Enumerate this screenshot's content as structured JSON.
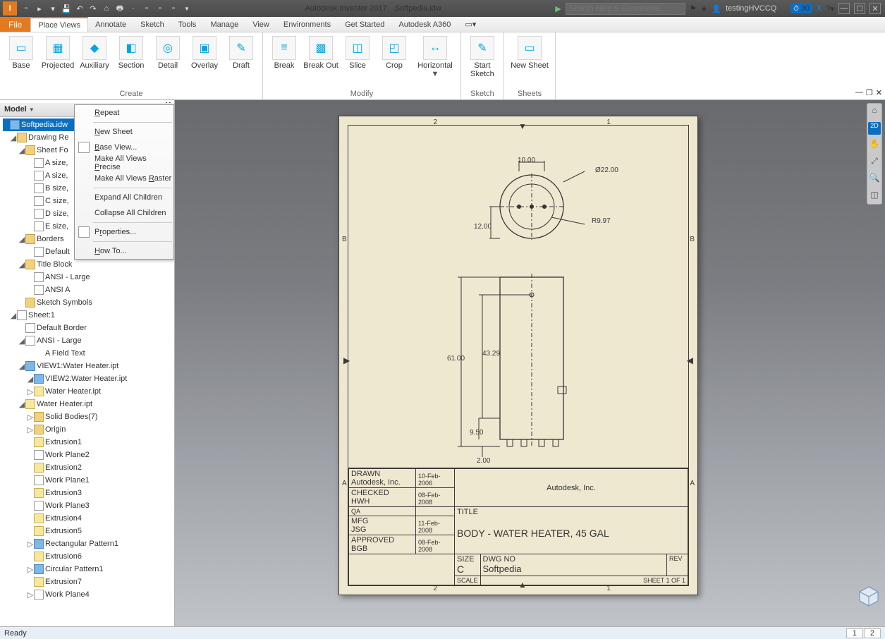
{
  "title": {
    "app": "Autodesk Inventor 2017",
    "doc": "Softpedia.idw"
  },
  "search_placeholder": "Search Help & Commands...",
  "user": "testingHVCCQ",
  "credits": "30",
  "menutabs": [
    "File",
    "Place Views",
    "Annotate",
    "Sketch",
    "Tools",
    "Manage",
    "View",
    "Environments",
    "Get Started",
    "Autodesk A360"
  ],
  "active_tab_index": 1,
  "ribbon": {
    "groups": [
      {
        "label": "Create",
        "items": [
          "Base",
          "Projected",
          "Auxiliary",
          "Section",
          "Detail",
          "Overlay",
          "Draft"
        ]
      },
      {
        "label": "Modify",
        "items": [
          "Break",
          "Break Out",
          "Slice",
          "Crop",
          "Horizontal"
        ]
      },
      {
        "label": "Sketch",
        "items": [
          "Start Sketch"
        ]
      },
      {
        "label": "Sheets",
        "items": [
          "New Sheet"
        ]
      }
    ]
  },
  "panel_title": "Model",
  "context_menu": [
    {
      "label": "Repeat",
      "u": 0
    },
    {
      "sep": true
    },
    {
      "label": "New Sheet",
      "dis": true,
      "u": 0
    },
    {
      "label": "Base View...",
      "u": 0,
      "ico": true
    },
    {
      "label": "Make All Views Precise",
      "dis": true,
      "u": 15
    },
    {
      "label": "Make All Views Raster",
      "u": 15
    },
    {
      "sep": true
    },
    {
      "label": "Expand All Children"
    },
    {
      "label": "Collapse All Children"
    },
    {
      "sep": true
    },
    {
      "label": "Properties...",
      "u": 1,
      "ico": true
    },
    {
      "sep": true
    },
    {
      "label": "How To...",
      "u": 0
    }
  ],
  "tree": [
    {
      "lvl": 0,
      "tw": "",
      "ic": "bluebox",
      "txt": "Softpedia.idw",
      "sel": true
    },
    {
      "lvl": 1,
      "tw": "◢",
      "ic": "folder",
      "txt": "Drawing Re"
    },
    {
      "lvl": 2,
      "tw": "◢",
      "ic": "folder",
      "txt": "Sheet Fo"
    },
    {
      "lvl": 3,
      "tw": "",
      "ic": "page",
      "txt": "A size,"
    },
    {
      "lvl": 3,
      "tw": "",
      "ic": "page",
      "txt": "A size,"
    },
    {
      "lvl": 3,
      "tw": "",
      "ic": "page",
      "txt": "B size,"
    },
    {
      "lvl": 3,
      "tw": "",
      "ic": "page",
      "txt": "C size,"
    },
    {
      "lvl": 3,
      "tw": "",
      "ic": "page",
      "txt": "D size,"
    },
    {
      "lvl": 3,
      "tw": "",
      "ic": "page",
      "txt": "E size,"
    },
    {
      "lvl": 2,
      "tw": "◢",
      "ic": "folder",
      "txt": "Borders"
    },
    {
      "lvl": 3,
      "tw": "",
      "ic": "page",
      "txt": "Default"
    },
    {
      "lvl": 2,
      "tw": "◢",
      "ic": "folder",
      "txt": "Title Block"
    },
    {
      "lvl": 3,
      "tw": "",
      "ic": "page",
      "txt": "ANSI - Large"
    },
    {
      "lvl": 3,
      "tw": "",
      "ic": "page",
      "txt": "ANSI A"
    },
    {
      "lvl": 2,
      "tw": "",
      "ic": "folder",
      "txt": "Sketch Symbols"
    },
    {
      "lvl": 1,
      "tw": "◢",
      "ic": "page",
      "txt": "Sheet:1"
    },
    {
      "lvl": 2,
      "tw": "",
      "ic": "page",
      "txt": "Default Border"
    },
    {
      "lvl": 2,
      "tw": "◢",
      "ic": "page",
      "txt": "ANSI - Large"
    },
    {
      "lvl": 3,
      "tw": "",
      "ic": "",
      "txt": "A Field Text"
    },
    {
      "lvl": 2,
      "tw": "◢",
      "ic": "bluebox",
      "txt": "VIEW1:Water Heater.ipt"
    },
    {
      "lvl": 3,
      "tw": "◢",
      "ic": "bluebox",
      "txt": "VIEW2:Water Heater.ipt"
    },
    {
      "lvl": 3,
      "tw": "▷",
      "ic": "cyl",
      "txt": "Water Heater.ipt"
    },
    {
      "lvl": 2,
      "tw": "◢",
      "ic": "cyl",
      "txt": "Water Heater.ipt"
    },
    {
      "lvl": 3,
      "tw": "▷",
      "ic": "folder",
      "txt": "Solid Bodies(7)"
    },
    {
      "lvl": 3,
      "tw": "▷",
      "ic": "folder",
      "txt": "Origin"
    },
    {
      "lvl": 3,
      "tw": "",
      "ic": "cyl",
      "txt": "Extrusion1"
    },
    {
      "lvl": 3,
      "tw": "",
      "ic": "page",
      "txt": "Work Plane2"
    },
    {
      "lvl": 3,
      "tw": "",
      "ic": "cyl",
      "txt": "Extrusion2"
    },
    {
      "lvl": 3,
      "tw": "",
      "ic": "page",
      "txt": "Work Plane1"
    },
    {
      "lvl": 3,
      "tw": "",
      "ic": "cyl",
      "txt": "Extrusion3"
    },
    {
      "lvl": 3,
      "tw": "",
      "ic": "page",
      "txt": "Work Plane3"
    },
    {
      "lvl": 3,
      "tw": "",
      "ic": "cyl",
      "txt": "Extrusion4"
    },
    {
      "lvl": 3,
      "tw": "",
      "ic": "cyl",
      "txt": "Extrusion5"
    },
    {
      "lvl": 3,
      "tw": "▷",
      "ic": "bluebox",
      "txt": "Rectangular Pattern1"
    },
    {
      "lvl": 3,
      "tw": "",
      "ic": "cyl",
      "txt": "Extrusion6"
    },
    {
      "lvl": 3,
      "tw": "▷",
      "ic": "bluebox",
      "txt": "Circular Pattern1"
    },
    {
      "lvl": 3,
      "tw": "",
      "ic": "cyl",
      "txt": "Extrusion7"
    },
    {
      "lvl": 3,
      "tw": "▷",
      "ic": "page",
      "txt": "Work Plane4"
    }
  ],
  "drawing": {
    "dims": {
      "d1": "10.00",
      "d2": "Ø22.00",
      "d3": "R9.97",
      "d4": "12.00",
      "h1": "61.00",
      "h2": "43.29",
      "h3": "9.50",
      "h4": "2.00"
    },
    "zone": {
      "top2": "2",
      "top1": "1",
      "leftB": "B",
      "leftA": "A",
      "rightB": "B",
      "rightA": "A",
      "bot2": "2",
      "bot1": "1"
    },
    "tb": {
      "drawn_l": "DRAWN",
      "drawn": "Autodesk, Inc.",
      "drawn_d": "10-Feb-2006",
      "checked_l": "CHECKED",
      "checked": "HWH",
      "checked_d": "08-Feb-2008",
      "qa_l": "QA",
      "mfg_l": "MFG",
      "mfg": "JSG",
      "mfg_d": "11-Feb-2008",
      "appr_l": "APPROVED",
      "appr": "BGB",
      "appr_d": "08-Feb-2008",
      "company": "Autodesk, Inc.",
      "title_l": "TITLE",
      "title": "BODY - WATER HEATER, 45 GAL",
      "size_l": "SIZE",
      "size": "C",
      "scale_l": "SCALE",
      "dwg_l": "DWG NO",
      "dwg": "Softpedia",
      "rev_l": "REV",
      "sheet": "SHEET 1  OF  1"
    }
  },
  "status": "Ready",
  "pages": [
    "1",
    "2"
  ]
}
